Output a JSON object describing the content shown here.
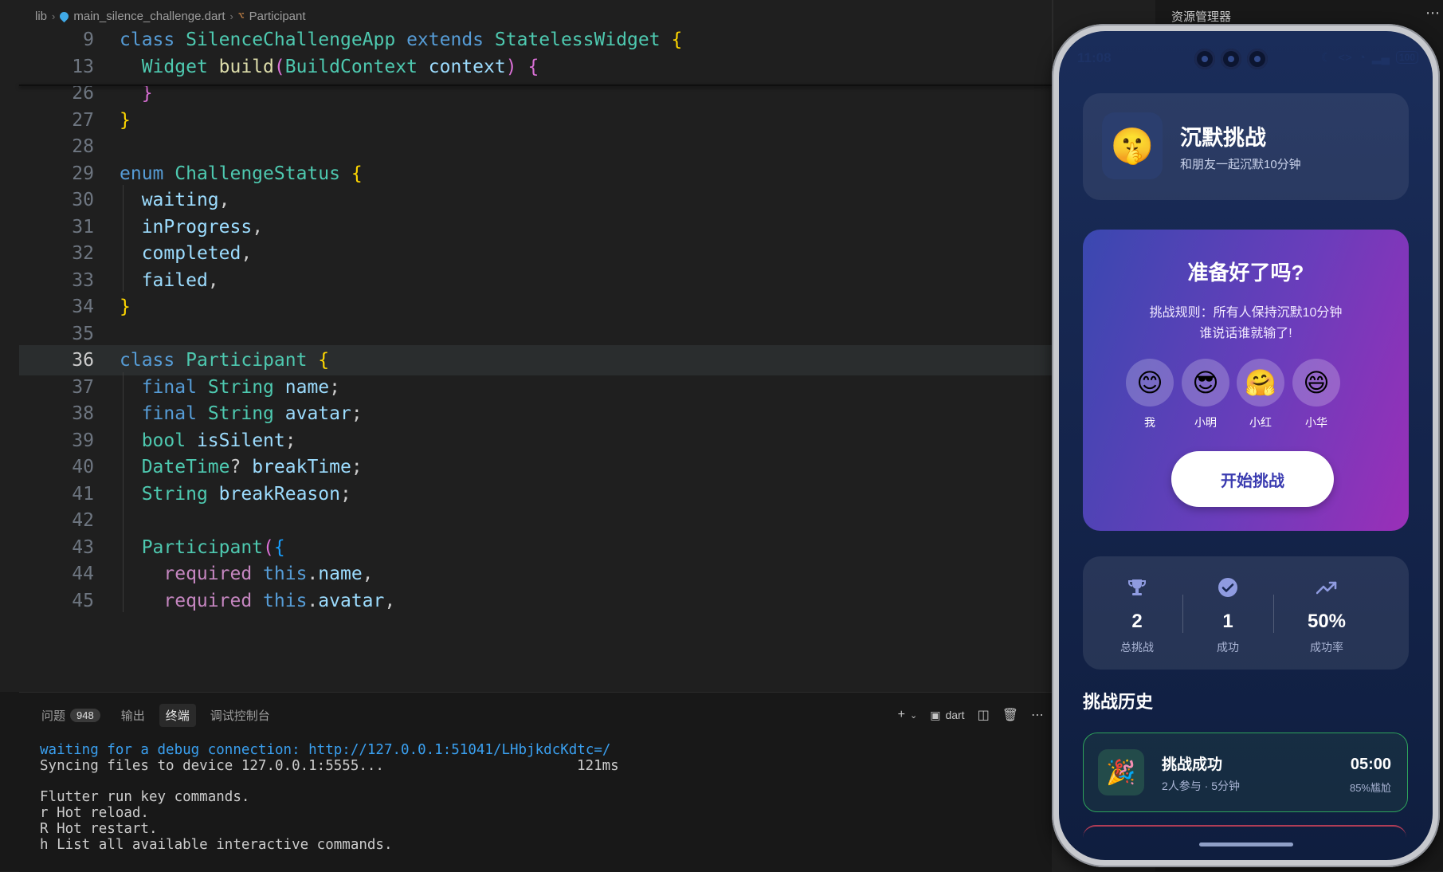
{
  "breadcrumb": {
    "folder": "lib",
    "file": "main_silence_challenge.dart",
    "symbol": "Participant"
  },
  "code_lines": [
    {
      "n": "9",
      "html": "<span class='kwb'>class</span> <span class='ty'>SilenceChallengeApp</span> <span class='kwb'>extends</span> <span class='ty'>StatelessWidget</span> <span class='br1'>{</span>"
    },
    {
      "n": "13",
      "html": "  <span class='ty'>Widget</span> <span class='fn'>build</span><span class='br2'>(</span><span class='ty'>BuildContext</span> <span class='va'>context</span><span class='br2'>)</span> <span class='br2'>{</span>"
    },
    {
      "n": "26",
      "html": "  <span class='br2'>}</span>"
    },
    {
      "n": "27",
      "html": "<span class='br1'>}</span>"
    },
    {
      "n": "28",
      "html": ""
    },
    {
      "n": "29",
      "html": "<span class='kwb'>enum</span> <span class='ty'>ChallengeStatus</span> <span class='br1'>{</span>"
    },
    {
      "n": "30",
      "html": "  <span class='va'>waiting</span><span class='pu'>,</span>"
    },
    {
      "n": "31",
      "html": "  <span class='va'>inProgress</span><span class='pu'>,</span>"
    },
    {
      "n": "32",
      "html": "  <span class='va'>completed</span><span class='pu'>,</span>"
    },
    {
      "n": "33",
      "html": "  <span class='va'>failed</span><span class='pu'>,</span>"
    },
    {
      "n": "34",
      "html": "<span class='br1'>}</span>"
    },
    {
      "n": "35",
      "html": ""
    },
    {
      "n": "36",
      "html": "<span class='kwb'>class</span> <span class='ty'>Participant</span> <span class='br1'>{</span>"
    },
    {
      "n": "37",
      "html": "  <span class='kwb'>final</span> <span class='ty'>String</span> <span class='va'>name</span><span class='pu'>;</span>"
    },
    {
      "n": "38",
      "html": "  <span class='kwb'>final</span> <span class='ty'>String</span> <span class='va'>avatar</span><span class='pu'>;</span>"
    },
    {
      "n": "39",
      "html": "  <span class='ty'>bool</span> <span class='va'>isSilent</span><span class='pu'>;</span>"
    },
    {
      "n": "40",
      "html": "  <span class='ty'>DateTime</span><span class='pu'>?</span> <span class='va'>breakTime</span><span class='pu'>;</span>"
    },
    {
      "n": "41",
      "html": "  <span class='ty'>String</span> <span class='va'>breakReason</span><span class='pu'>;</span>"
    },
    {
      "n": "42",
      "html": ""
    },
    {
      "n": "43",
      "html": "  <span class='ty'>Participant</span><span class='br2'>(</span><span class='br3'>{</span>"
    },
    {
      "n": "44",
      "html": "    <span class='kw'>required</span> <span class='kwb'>this</span><span class='pu'>.</span><span class='va'>name</span><span class='pu'>,</span>"
    },
    {
      "n": "45",
      "html": "    <span class='kw'>required</span> <span class='kwb'>this</span><span class='pu'>.</span><span class='va'>avatar</span><span class='pu'>,</span>"
    }
  ],
  "panel": {
    "tabs": [
      {
        "label": "问题",
        "badge": "948"
      },
      {
        "label": "输出"
      },
      {
        "label": "终端",
        "active": true
      },
      {
        "label": "调试控制台"
      }
    ],
    "shell_label": "dart"
  },
  "terminal": {
    "lines": [
      "waiting for a debug connection: http://127.0.0.1:51041/LHbjkdcKdtc=/",
      "Syncing files to device 127.0.0.1:5555...",
      "",
      "Flutter run key commands.",
      "r Hot reload.",
      "R Hot restart.",
      "h List all available interactive commands."
    ],
    "sync_time": "121ms"
  },
  "explorer": {
    "title": "资源管理器"
  },
  "phone": {
    "status": {
      "time": "11:08",
      "battery": "100"
    },
    "header": {
      "emoji": "🤫",
      "title": "沉默挑战",
      "subtitle": "和朋友一起沉默10分钟"
    },
    "ready": {
      "title": "准备好了吗?",
      "rule1": "挑战规则：所有人保持沉默10分钟",
      "rule2": "谁说话谁就输了!",
      "participants": [
        {
          "emoji": "😊",
          "name": "我"
        },
        {
          "emoji": "😎",
          "name": "小明"
        },
        {
          "emoji": "🤗",
          "name": "小红"
        },
        {
          "emoji": "😄",
          "name": "小华"
        }
      ],
      "start_label": "开始挑战"
    },
    "stats": [
      {
        "icon": "trophy-icon",
        "value": "2",
        "label": "总挑战"
      },
      {
        "icon": "check-circle-icon",
        "value": "1",
        "label": "成功"
      },
      {
        "icon": "trending-up-icon",
        "value": "50%",
        "label": "成功率"
      }
    ],
    "history": {
      "title": "挑战历史",
      "items": [
        {
          "emoji": "🎉",
          "title": "挑战成功",
          "subtitle": "2人参与 · 5分钟",
          "time": "05:00",
          "rate": "85%尴尬"
        }
      ]
    },
    "colors": {
      "accent": "#3a3bb0",
      "success_border": "#2ea35b",
      "stat_icon": "#8f9be0"
    }
  }
}
